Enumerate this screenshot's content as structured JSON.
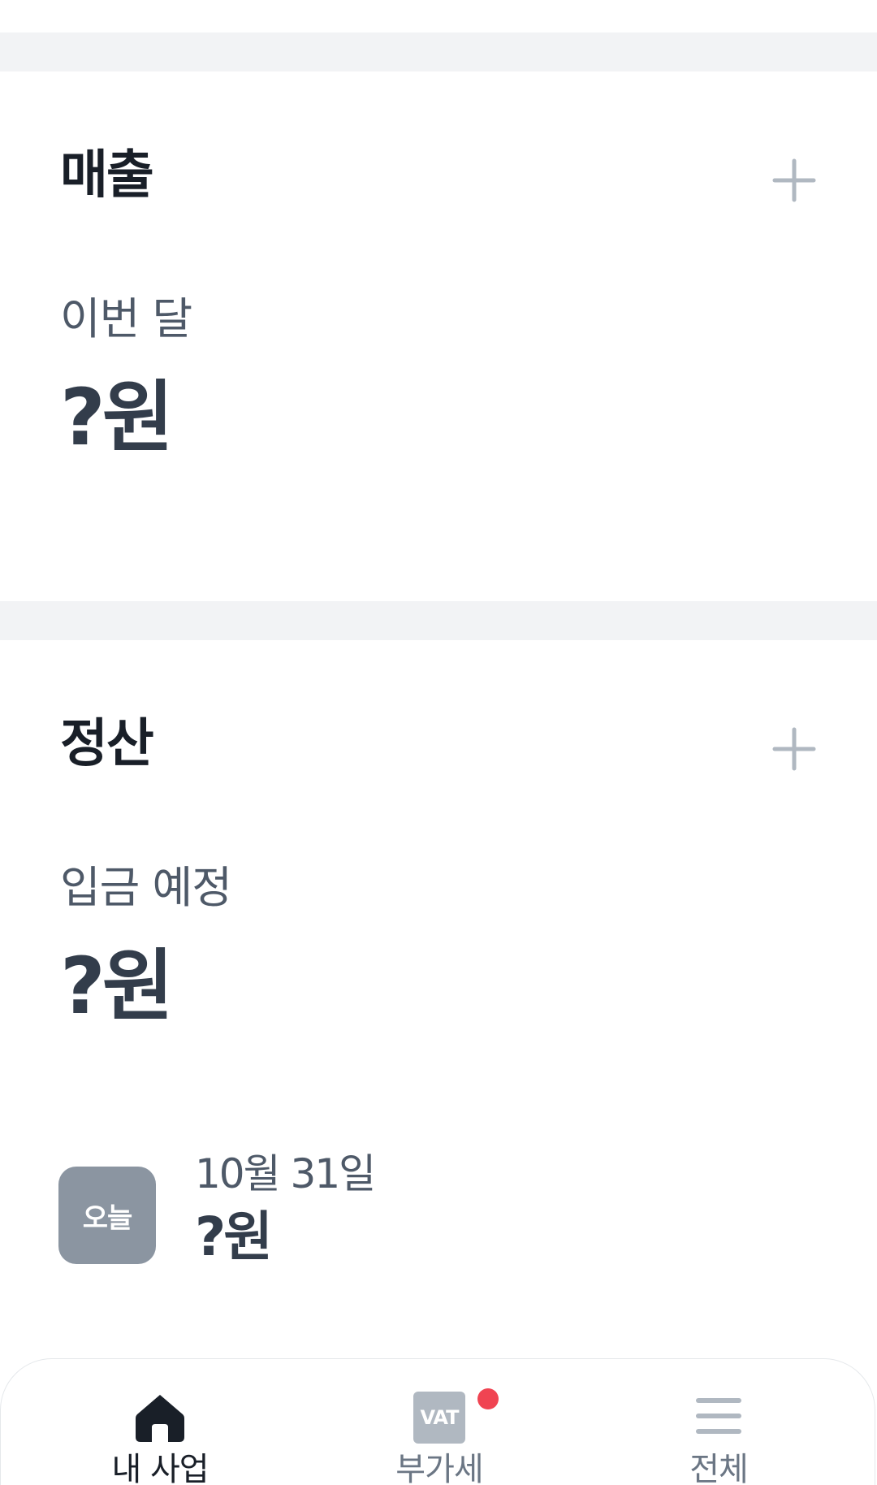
{
  "sales": {
    "title": "매출",
    "add_icon": "plus-icon",
    "metric_label": "이번 달",
    "metric_value": "?원"
  },
  "settlement": {
    "title": "정산",
    "add_icon": "plus-icon",
    "metric_label": "입금 예정",
    "metric_value": "?원",
    "today": {
      "badge": "오늘",
      "date": "10월 31일",
      "amount": "?원"
    }
  },
  "bottom_nav": {
    "items": [
      {
        "label": "내 사업",
        "icon": "home-icon",
        "active": true
      },
      {
        "label": "부가세",
        "icon": "vat-icon",
        "badge_text": "VAT",
        "notification_dot": true
      },
      {
        "label": "전체",
        "icon": "menu-icon"
      }
    ]
  },
  "colors": {
    "background": "#ffffff",
    "divider": "#f2f3f5",
    "title": "#191f28",
    "label": "#4e5968",
    "value": "#333d4b",
    "icon_gray": "#b0b8c1",
    "badge_gray": "#8b95a1",
    "notification": "#f04452"
  }
}
